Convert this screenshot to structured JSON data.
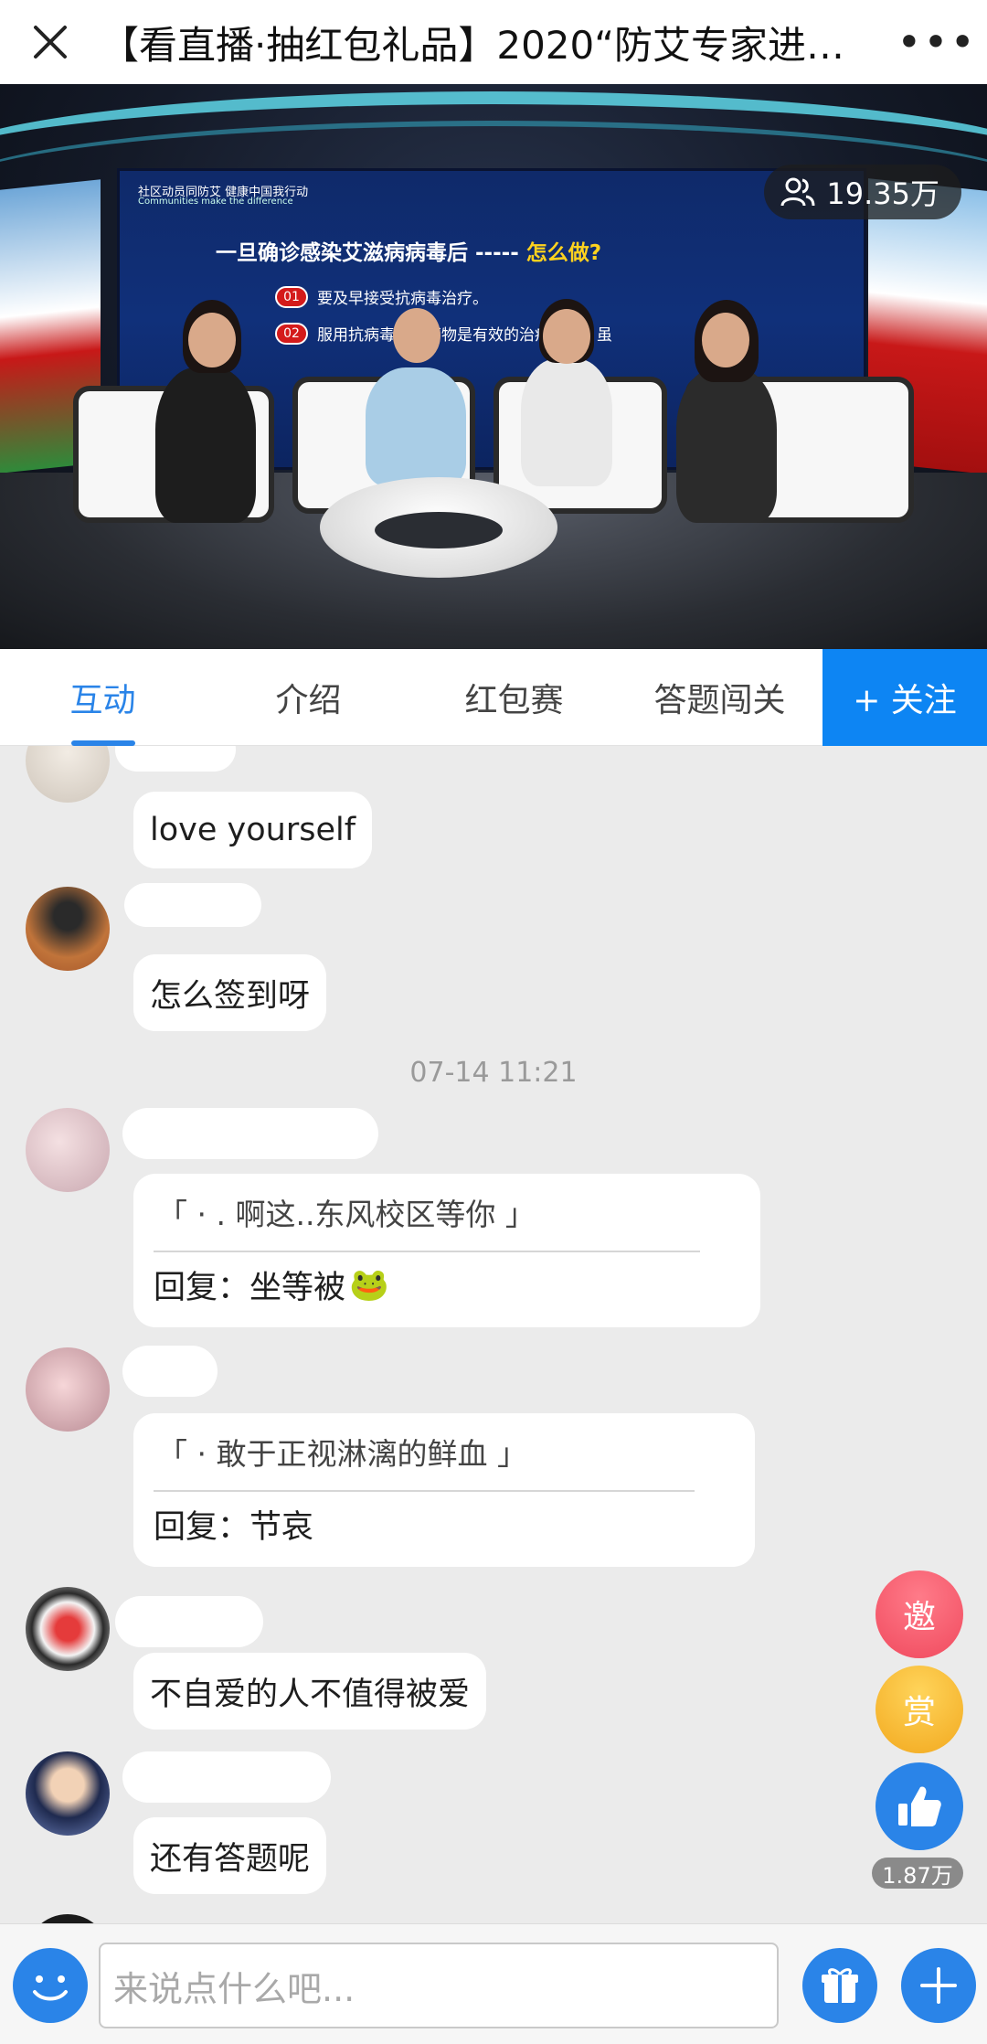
{
  "header": {
    "title": "【看直播·抽红包礼品】2020“防艾专家进…",
    "close_icon": "close-icon",
    "more_icon": "more-dots-icon",
    "more_label": "•••"
  },
  "video": {
    "viewer_count": "19.35万",
    "screen_heading_cn": "社区动员同防艾  健康中国我行动",
    "screen_heading_en": "Communities make the difference",
    "screen_title_prefix": "一旦确诊感染艾滋病病毒后 -----",
    "screen_title_highlight": "怎么做?",
    "points": [
      {
        "num": "01",
        "text": "要及早接受抗病毒治疗。"
      },
      {
        "num": "02",
        "text": "服用抗病毒治疗药物是有效的治疗手段，虽"
      }
    ]
  },
  "tabs": [
    {
      "label": "互动",
      "active": true
    },
    {
      "label": "介绍",
      "active": false
    },
    {
      "label": "红包赛",
      "active": false
    },
    {
      "label": "答题闯关",
      "active": false
    }
  ],
  "follow_label": "+ 关注",
  "chat": {
    "messages": [
      {
        "text": "love yourself"
      },
      {
        "text": "怎么签到呀"
      },
      {
        "quote": "「 ·                          . 啊这..东风校区等你 」",
        "reply": "回复：坐等被",
        "emoji": "🐸"
      },
      {
        "quote": "「 ·                         敢于正视淋漓的鲜血 」",
        "reply": "回复：节哀"
      },
      {
        "text": "不自爱的人不值得被爱"
      },
      {
        "text": "还有答题呢"
      }
    ],
    "timestamp": "07-14 11:21"
  },
  "side_actions": {
    "invite_label": "邀",
    "reward_label": "赏",
    "like_count": "1.87万"
  },
  "composer": {
    "placeholder": "来说点什么吧..."
  },
  "colors": {
    "accent": "#2a84e8",
    "follow": "#0d85f3",
    "invite": "#f25a6d",
    "reward": "#f5b52a"
  }
}
